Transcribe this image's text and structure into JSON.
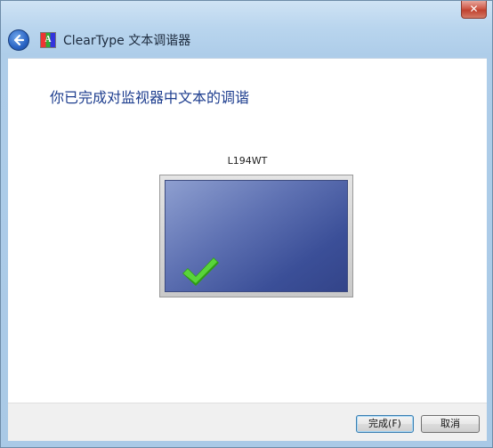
{
  "window": {
    "title": "ClearType 文本调谐器",
    "close_glyph": "✕",
    "app_icon_letter": "A"
  },
  "main": {
    "heading": "你已完成对监视器中文本的调谐",
    "monitor_name": "L194WT"
  },
  "footer": {
    "finish_label": "完成(F)",
    "cancel_label": "取消"
  },
  "colors": {
    "heading": "#1e3e8f",
    "screen": "#3b4f98",
    "check": "#3fb51f"
  }
}
